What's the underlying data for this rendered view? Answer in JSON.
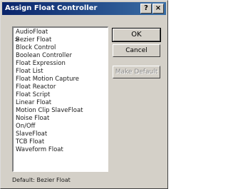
{
  "window": {
    "title": "Assign Float Controller",
    "help_label": "?",
    "close_label": "×"
  },
  "list": {
    "items": [
      "AudioFloat",
      "Bezier Float",
      "Block Control",
      "Boolean Controller",
      "Float Expression",
      "Float List",
      "Float Motion Capture",
      "Float Reactor",
      "Float Script",
      "Linear Float",
      "Motion Clip SlaveFloat",
      "Noise Float",
      "On/Off",
      "SlaveFloat",
      "TCB Float",
      "Waveform Float"
    ],
    "selected": "Bezier Float"
  },
  "buttons": {
    "ok": "OK",
    "cancel": "Cancel",
    "make_default": "Make Default"
  },
  "status": {
    "default_text": "Default: Bezier Float"
  }
}
